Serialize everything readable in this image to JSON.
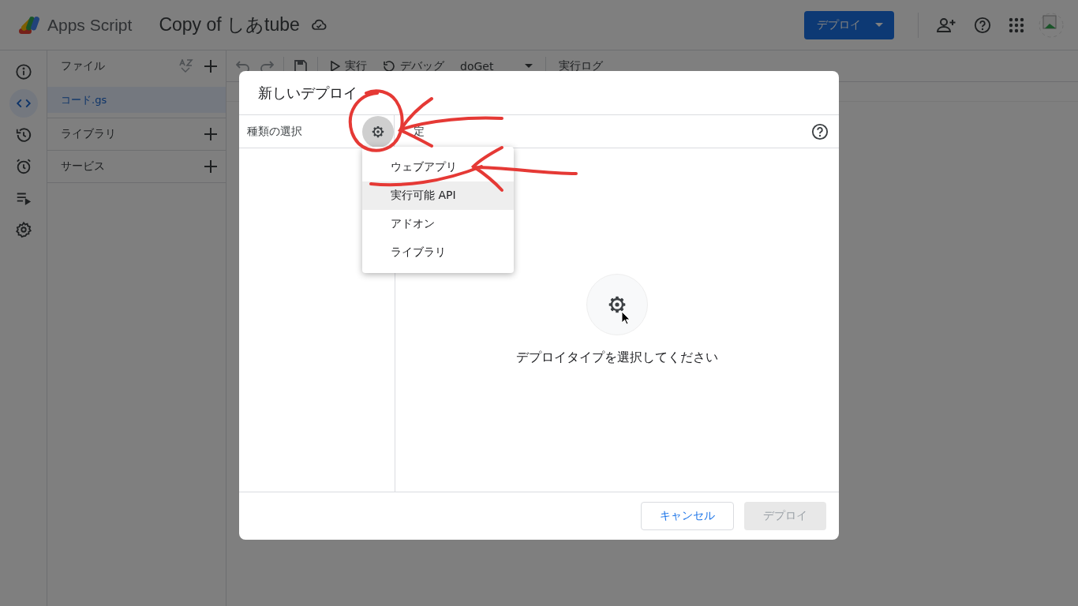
{
  "header": {
    "app_name": "Apps Script",
    "project_title": "Copy of しあtube",
    "deploy_button": "デプロイ"
  },
  "rail": [
    {
      "kind": "info",
      "selected": false
    },
    {
      "kind": "code",
      "selected": true
    },
    {
      "kind": "history",
      "selected": false
    },
    {
      "kind": "alarm",
      "selected": false
    },
    {
      "kind": "executions",
      "selected": false
    },
    {
      "kind": "settings",
      "selected": false
    }
  ],
  "files": {
    "title": "ファイル",
    "items": [
      {
        "name": "コード.gs",
        "selected": true
      }
    ]
  },
  "sections": [
    {
      "title": "ライブラリ"
    },
    {
      "title": "サービス"
    }
  ],
  "toolbar": {
    "run": "実行",
    "debug": "デバッグ",
    "function": "doGet",
    "log": "実行ログ"
  },
  "dialog": {
    "title": "新しいデプロイ",
    "type_label": "種類の選択",
    "type_button": {
      "active": true
    },
    "settings_label": "定",
    "empty_message": "デプロイタイプを選択してください",
    "cancel": "キャンセル",
    "deploy": {
      "label": "デプロイ",
      "disabled": true
    },
    "menu": [
      {
        "label": "ウェブアプリ",
        "highlighted": false
      },
      {
        "label": "実行可能 API",
        "highlighted": true
      },
      {
        "label": "アドオン",
        "highlighted": false
      },
      {
        "label": "ライブラリ",
        "highlighted": false
      }
    ]
  }
}
